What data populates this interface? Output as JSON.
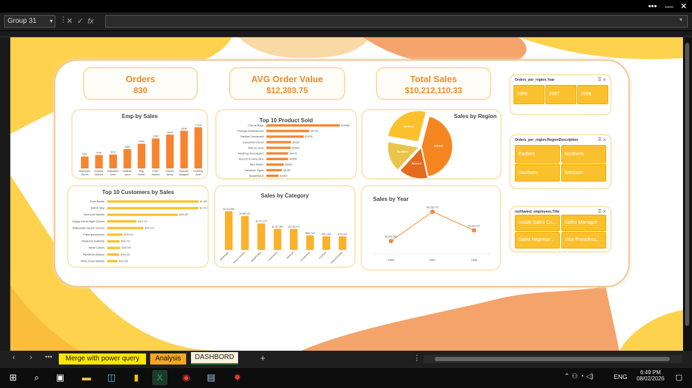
{
  "namebox": "Group 31",
  "formula_fx": "fx",
  "kpis": [
    {
      "title": "Orders",
      "value": "830"
    },
    {
      "title": "AVG Order Value",
      "value": "$12,303.75"
    },
    {
      "title": "Total Sales",
      "value": "$10,212,110.33"
    }
  ],
  "emp_chart": {
    "title": "Emp by Sales"
  },
  "top_products": {
    "title": "Top 10 Product Sold"
  },
  "sales_region": {
    "title": "Sales by Region"
  },
  "top_customers": {
    "title": "Top 10 Customers by Sales"
  },
  "sales_category": {
    "title": "Sales by Category"
  },
  "sales_year": {
    "title": "Sales by Year"
  },
  "slicers": {
    "year": {
      "title": "Orders_por_region.Year",
      "items": [
        "1996",
        "1997",
        "1998"
      ]
    },
    "region": {
      "title": "Orders_por_region.RegionDescription",
      "items": [
        "Eastern",
        "Northern",
        "Southern",
        "Western"
      ]
    },
    "emp": {
      "title": "northwind_employees.Title",
      "items": [
        "Inside Sales Co...",
        "Sales Manager",
        "Sales Represe...",
        "Vice President,..."
      ]
    }
  },
  "tabs": {
    "t1": "Merge with power query",
    "t2": "Analysis",
    "t3": "DASHBORD"
  },
  "clock": {
    "time": "6:49 PM",
    "date": "08/02/2026",
    "lang": "ENG"
  },
  "colors": {
    "accent": "#f08a2a",
    "bar": "#f5862f",
    "yellow": "#fbc02d"
  },
  "chart_data": [
    {
      "type": "bar",
      "title": "Emp by Sales",
      "categories": [
        "Buchanan, Steven",
        "Suyama, Michael",
        "Dodsworth, Anne",
        "Callahan, Laura",
        "King, Robert",
        "Fuller, Andrew",
        "Davolio, Nancy",
        "Peacock, Margaret",
        "Leverling, Janet"
      ],
      "values": [
        516,
        578,
        602,
        836,
        1065,
        1292,
        1460,
        1624,
        1770
      ],
      "labels": [
        "516K",
        "578K",
        "602K",
        "836K",
        "1065K",
        "1292K",
        "1460K",
        "1624K",
        "1770K"
      ]
    },
    {
      "type": "bar",
      "title": "Top 10 Product Sold",
      "categories": [
        "Côte de Blaye",
        "Thüringer Rostbratwurst",
        "Raclette Courdavault",
        "Camembert Pierrot",
        "Tarte au sucre",
        "Manjimup Dried Apples",
        "Gnocchi di nonna Alice",
        "Alice Mutton",
        "Carnarvon Tigers",
        "Mozzarella di"
      ],
      "values": [
        149984,
        87736,
        76296,
        50287,
        49828,
        44743,
        44385,
        35482,
        31987,
        24900
      ],
      "labels": [
        "$149984",
        "$87736",
        "$76296",
        "$50287",
        "$49828",
        "$44743",
        "$44385",
        "$35482",
        "$31987",
        "$24900"
      ]
    },
    {
      "type": "pie",
      "title": "Sales by Region",
      "categories": [
        "Eastern",
        "Western",
        "Southern",
        "Northern"
      ],
      "values": [
        3915,
        1406,
        1460,
        2410
      ]
    },
    {
      "type": "bar",
      "title": "Top 10 Customers by Sales",
      "categories": [
        "Ernst Handel",
        "QUICK-Stop",
        "Save-a-lot Markets",
        "Hungry Owl All-Night Grocers",
        "Rattlesnake Canyon Grocery",
        "Folies gourmandes",
        "Berglunds snabbköp",
        "Hanari Carnes",
        "HILARIÓN-Abastos",
        "White Clover Markets"
      ],
      "values": [
        1185202,
        1179048,
        915487,
        379174,
        470210,
        200000,
        161712,
        166755,
        156154,
        132045
      ],
      "labels": [
        "$1,185,202",
        "$1,179,048",
        "$915,487",
        "$379,174",
        "$470,210",
        "$200,000",
        "$161,712",
        "$166,755",
        "$156,154",
        "$132,045"
      ]
    },
    {
      "type": "bar",
      "title": "Sales by Category",
      "categories": [
        "Beverages",
        "Dairy Products",
        "Meat/Poultry",
        "Confections",
        "Seafood",
        "Condiments",
        "Produce",
        "Grains/Cereals"
      ],
      "values": [
        2144955,
        1889162,
        1471273,
        1167084,
        1163075,
        802754,
        757045,
        751604
      ],
      "labels": [
        "$2,144,955",
        "$1,889,162",
        "$1,471,273",
        "$1,167,084",
        "$1,163,075",
        "$802,754",
        "$757,045",
        "$751,604"
      ]
    },
    {
      "type": "line",
      "title": "Sales by Year",
      "x": [
        "1996",
        "1997",
        "1998"
      ],
      "values": [
        2690063,
        4256779,
        3264270
      ],
      "labels": [
        "$2,690,063",
        "$4,256,779",
        "$3,264,270"
      ]
    }
  ]
}
